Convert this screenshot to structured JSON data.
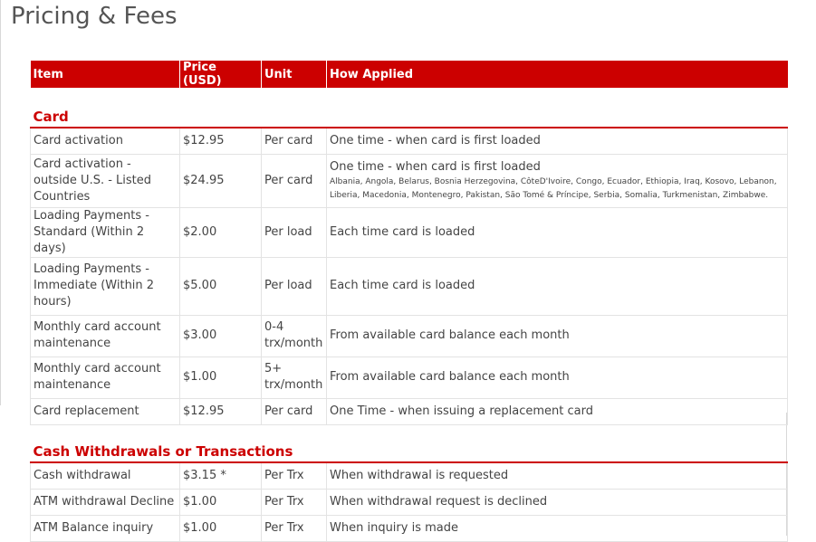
{
  "page": {
    "title": "Pricing & Fees"
  },
  "table": {
    "headers": [
      "Item",
      "Price (USD)",
      "Unit",
      "How Applied"
    ],
    "sections": [
      {
        "name": "Card",
        "rows": [
          {
            "item": "Card activation",
            "price": "$12.95",
            "unit": "Per card",
            "applied": "One time - when card is first loaded"
          },
          {
            "item": "Card activation - outside U.S. - Listed Countries",
            "price": "$24.95",
            "unit": "Per card",
            "applied": "One time - when card is first loaded",
            "countries": "Albania, Angola, Belarus, Bosnia Herzegovina, CôteD'Ivoire, Congo, Ecuador, Ethiopia, Iraq, Kosovo, Lebanon, Liberia, Macedonia, Montenegro, Pakistan, São Tomé & Príncipe, Serbia, Somalia, Turkmenistan, Zimbabwe."
          },
          {
            "item": "Loading Payments - Standard (Within 2 days)",
            "price": "$2.00",
            "unit": "Per load",
            "applied": "Each time card is loaded"
          },
          {
            "item": "Loading Payments - Immediate (Within 2 hours)",
            "price": "$5.00",
            "unit": "Per load",
            "applied": "Each time card is loaded"
          },
          {
            "item": "Monthly card account maintenance",
            "price": "$3.00",
            "unit": "0-4 trx/month",
            "applied": "From available card balance each month"
          },
          {
            "item": "Monthly card account maintenance",
            "price": "$1.00",
            "unit": "5+ trx/month",
            "applied": "From available card balance each month"
          },
          {
            "item": "Card replacement",
            "price": "$12.95",
            "unit": "Per card",
            "applied": "One Time - when issuing a replacement card"
          }
        ]
      },
      {
        "name": "Cash Withdrawals or Transactions",
        "rows": [
          {
            "item": "Cash withdrawal",
            "price": "$3.15 *",
            "unit": "Per Trx",
            "applied": "When withdrawal is requested"
          },
          {
            "item": "ATM withdrawal Decline",
            "price": "$1.00",
            "unit": "Per Trx",
            "applied": "When withdrawal request is declined"
          },
          {
            "item": "ATM Balance inquiry",
            "price": "$1.00",
            "unit": "Per Trx",
            "applied": "When inquiry is made"
          }
        ]
      }
    ]
  }
}
